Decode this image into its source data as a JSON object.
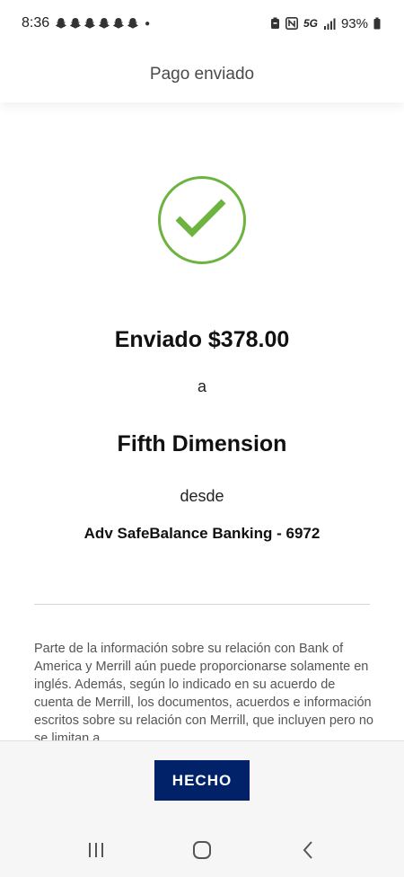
{
  "status_bar": {
    "time": "8:36",
    "notification_icons": [
      "snapchat-icon",
      "snapchat-icon",
      "snapchat-icon",
      "snapchat-icon",
      "snapchat-icon",
      "snapchat-icon"
    ],
    "network": "5G",
    "battery": "93%"
  },
  "header": {
    "title": "Pago enviado"
  },
  "confirmation": {
    "amount_line": "Enviado $378.00",
    "to_word": "a",
    "payee": "Fifth Dimension",
    "from_word": "desde",
    "account": "Adv SafeBalance Banking - 6972",
    "check_color": "#6db33f"
  },
  "disclaimer": {
    "text": "Parte de la información sobre su relación con Bank of America y Merrill aún puede proporcionarse solamente en inglés. Además, según lo indicado en su acuerdo de cuenta de Merrill, los documentos, acuerdos e información escritos sobre su relación con Merrill, que incluyen pero no se limitan a"
  },
  "footer": {
    "done_label": "HECHO",
    "button_color": "#012169"
  },
  "nav": {
    "items": [
      "recent-apps-icon",
      "home-icon",
      "back-icon"
    ]
  }
}
